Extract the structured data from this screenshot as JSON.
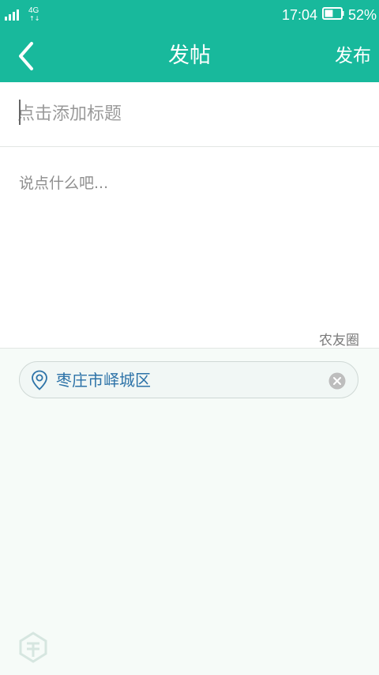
{
  "status_bar": {
    "network": "4G",
    "network_arrows": "↑↓",
    "time": "17:04",
    "battery_percent": "52%",
    "battery_level": 0.52,
    "icons": [
      "signal-icon",
      "battery-icon"
    ]
  },
  "header": {
    "title": "发帖",
    "publish_label": "发布",
    "back_icon": "chevron-left-icon"
  },
  "form": {
    "title_placeholder": "点击添加标题",
    "title_value": "",
    "content_placeholder": "说点什么吧...",
    "content_value": "",
    "circle_label": "农友圈"
  },
  "location": {
    "text": "枣庄市峄城区",
    "pin_icon": "location-pin-icon",
    "clear_icon": "clear-icon"
  },
  "colors": {
    "primary": "#18b99c",
    "location_text": "#2d73a8",
    "background": "#f6fbf8"
  }
}
